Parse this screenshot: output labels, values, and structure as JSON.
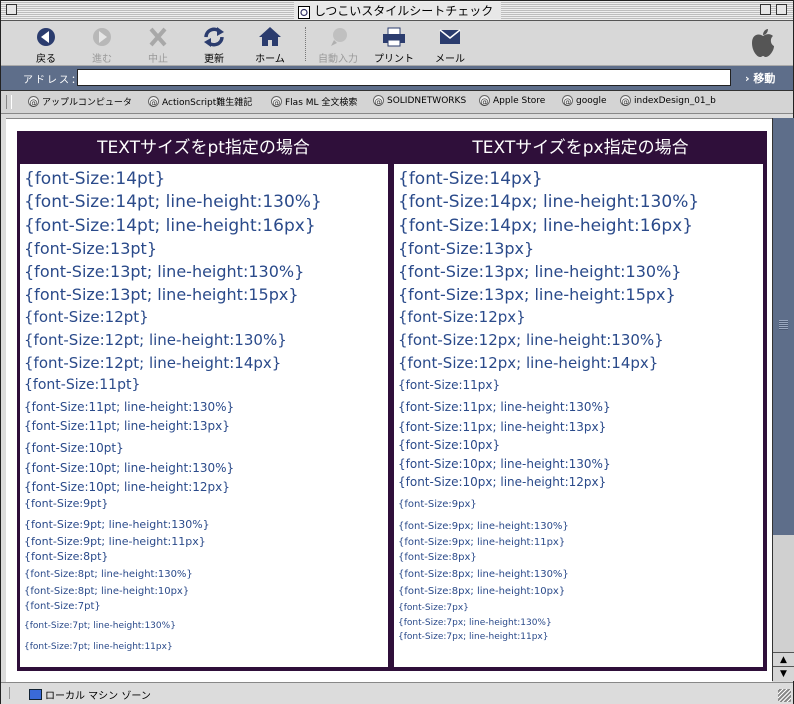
{
  "window": {
    "title": "しつこいスタイルシートチェック"
  },
  "toolbar": {
    "back": "戻る",
    "forward": "進む",
    "stop": "中止",
    "refresh": "更新",
    "home": "ホーム",
    "autofill": "自動入力",
    "print": "プリント",
    "mail": "メール"
  },
  "address": {
    "label": "アドレス：",
    "value": "",
    "go": "移動"
  },
  "favorites": [
    "アップルコンピュータ",
    "ActionScript難生雑記",
    "Flas ML 全文検索",
    "SOLIDNETWORKS",
    "Apple Store",
    "google",
    "indexDesign_01_b"
  ],
  "table": {
    "left_header": "TEXTサイズをpt指定の場合",
    "right_header": "TEXTサイズをpx指定の場合",
    "left_rows": [
      "{font-Size:14pt}",
      "{font-Size:14pt; line-height:130%}",
      "{font-Size:14pt; line-height:16px}",
      "{font-Size:13pt}",
      "{font-Size:13pt; line-height:130%}",
      "{font-Size:13pt; line-height:15px}",
      "{font-Size:12pt}",
      "{font-Size:12pt; line-height:130%}",
      "{font-Size:12pt; line-height:14px}",
      "{font-Size:11pt}",
      "{font-Size:11pt; line-height:130%}",
      "{font-Size:11pt; line-height:13px}",
      "{font-Size:10pt}",
      "{font-Size:10pt; line-height:130%}",
      "{font-Size:10pt; line-height:12px}",
      "{font-Size:9pt}",
      "{font-Size:9pt; line-height:130%}",
      "{font-Size:9pt; line-height:11px}",
      "{font-Size:8pt}",
      "{font-Size:8pt; line-height:130%}",
      "{font-Size:8pt; line-height:10px}",
      "{font-Size:7pt}",
      "{font-Size:7pt; line-height:130%}",
      "{font-Size:7pt; line-height:11px}"
    ],
    "right_rows": [
      "{font-Size:14px}",
      "{font-Size:14px; line-height:130%}",
      "{font-Size:14px; line-height:16px}",
      "{font-Size:13px}",
      "{font-Size:13px; line-height:130%}",
      "{font-Size:13px; line-height:15px}",
      "{font-Size:12px}",
      "{font-Size:12px; line-height:130%}",
      "{font-Size:12px; line-height:14px}",
      "{font-Size:11px}",
      "{font-Size:11px; line-height:130%}",
      "{font-Size:11px; line-height:13px}",
      "{font-Size:10px}",
      "{font-Size:10px; line-height:130%}",
      "{font-Size:10px; line-height:12px}",
      "{font-Size:9px}",
      "{font-Size:9px; line-height:130%}",
      "{font-Size:9px; line-height:11px}",
      "{font-Size:8px}",
      "{font-Size:8px; line-height:130%}",
      "{font-Size:8px; line-height:10px}",
      "{font-Size:7px}",
      "{font-Size:7px; line-height:130%}",
      "{font-Size:7px; line-height:11px}"
    ]
  },
  "status": {
    "zone": "ローカル マシン ゾーン"
  },
  "colors": {
    "header_bg": "#2f0f3a",
    "text_blue": "#2a4a8a",
    "address_bar": "#5e6e8a"
  }
}
